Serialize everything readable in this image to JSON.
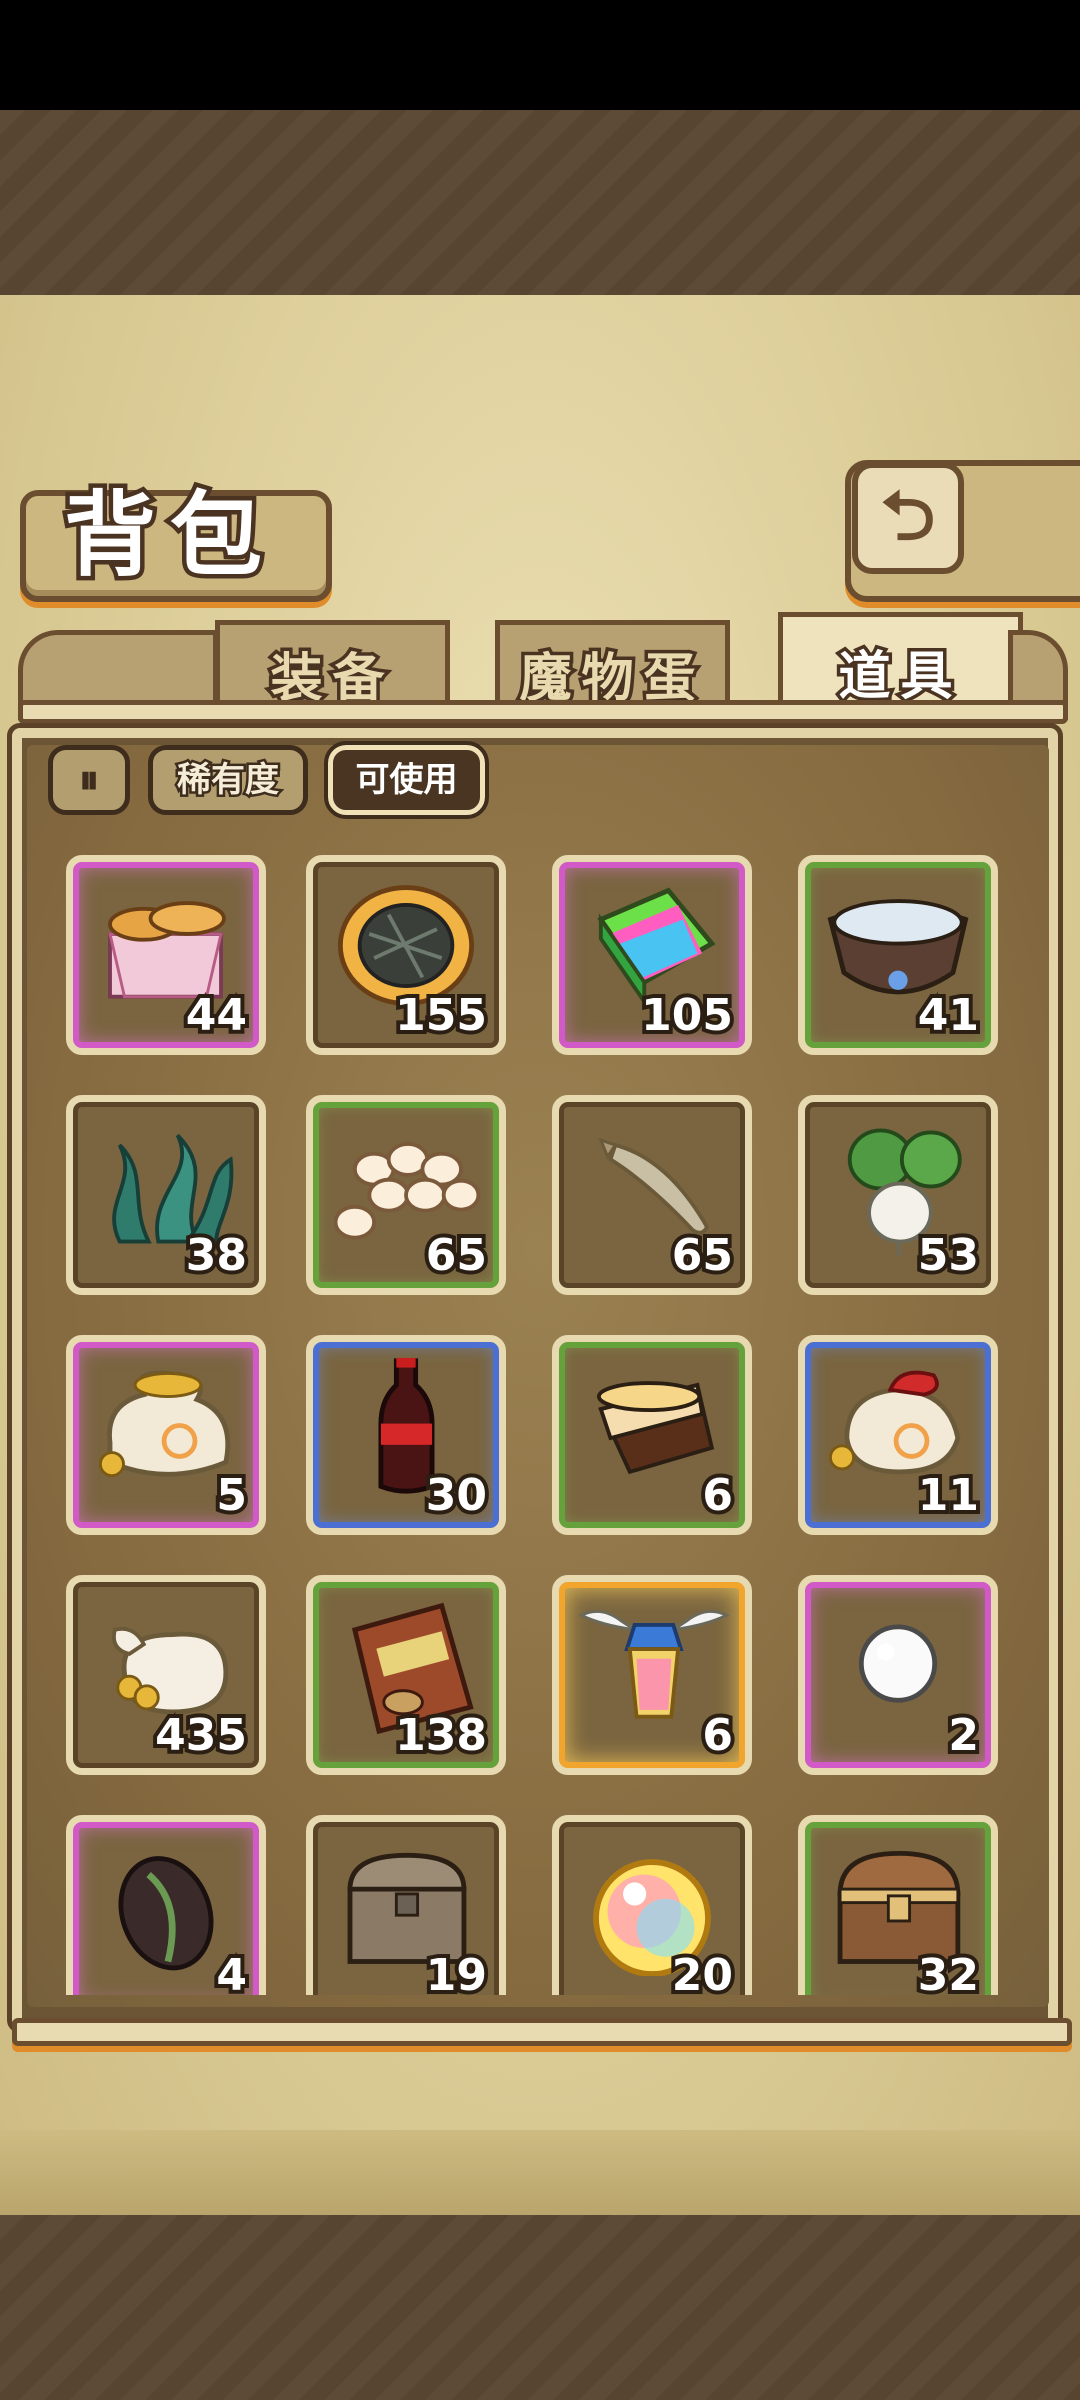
{
  "header": {
    "title": "背包",
    "back_icon": "back-arrow-icon"
  },
  "tabs": [
    {
      "label": "装备",
      "active": false
    },
    {
      "label": "魔物蛋",
      "active": false
    },
    {
      "label": "道具",
      "active": true
    }
  ],
  "filters": {
    "sort_icon": "sort-toggle-icon",
    "rarity_label": "稀有度",
    "usable_label": "可使用"
  },
  "colors": {
    "purple": "#d159c8",
    "green": "#66a23c",
    "blue": "#4c6fd3",
    "gold": "#f2a52c",
    "plain": "#5a4427"
  },
  "items": [
    {
      "icon": "bread-basket-icon",
      "count": "44",
      "rarity": "purple"
    },
    {
      "icon": "melon-bread-icon",
      "count": "155",
      "rarity": "plain"
    },
    {
      "icon": "rainbow-book-icon",
      "count": "105",
      "rarity": "purple"
    },
    {
      "icon": "water-bowl-icon",
      "count": "41",
      "rarity": "green"
    },
    {
      "icon": "seaweed-icon",
      "count": "38",
      "rarity": "plain"
    },
    {
      "icon": "eggs-pile-icon",
      "count": "65",
      "rarity": "green"
    },
    {
      "icon": "dried-fish-icon",
      "count": "65",
      "rarity": "plain"
    },
    {
      "icon": "turnip-icon",
      "count": "53",
      "rarity": "plain"
    },
    {
      "icon": "gold-coin-sack-icon",
      "count": "5",
      "rarity": "purple"
    },
    {
      "icon": "cola-bottle-icon",
      "count": "30",
      "rarity": "blue"
    },
    {
      "icon": "pudding-icon",
      "count": "6",
      "rarity": "green"
    },
    {
      "icon": "coin-pouch-icon",
      "count": "11",
      "rarity": "blue"
    },
    {
      "icon": "money-bag-icon",
      "count": "435",
      "rarity": "plain"
    },
    {
      "icon": "snack-bag-icon",
      "count": "138",
      "rarity": "green"
    },
    {
      "icon": "winged-lantern-icon",
      "count": "6",
      "rarity": "gold"
    },
    {
      "icon": "white-pearl-icon",
      "count": "2",
      "rarity": "purple"
    },
    {
      "icon": "dark-seed-icon",
      "count": "4",
      "rarity": "purple"
    },
    {
      "icon": "wooden-chest-icon",
      "count": "19",
      "rarity": "plain"
    },
    {
      "icon": "rainbow-orb-icon",
      "count": "20",
      "rarity": "plain"
    },
    {
      "icon": "treasure-chest-icon",
      "count": "32",
      "rarity": "green"
    }
  ]
}
